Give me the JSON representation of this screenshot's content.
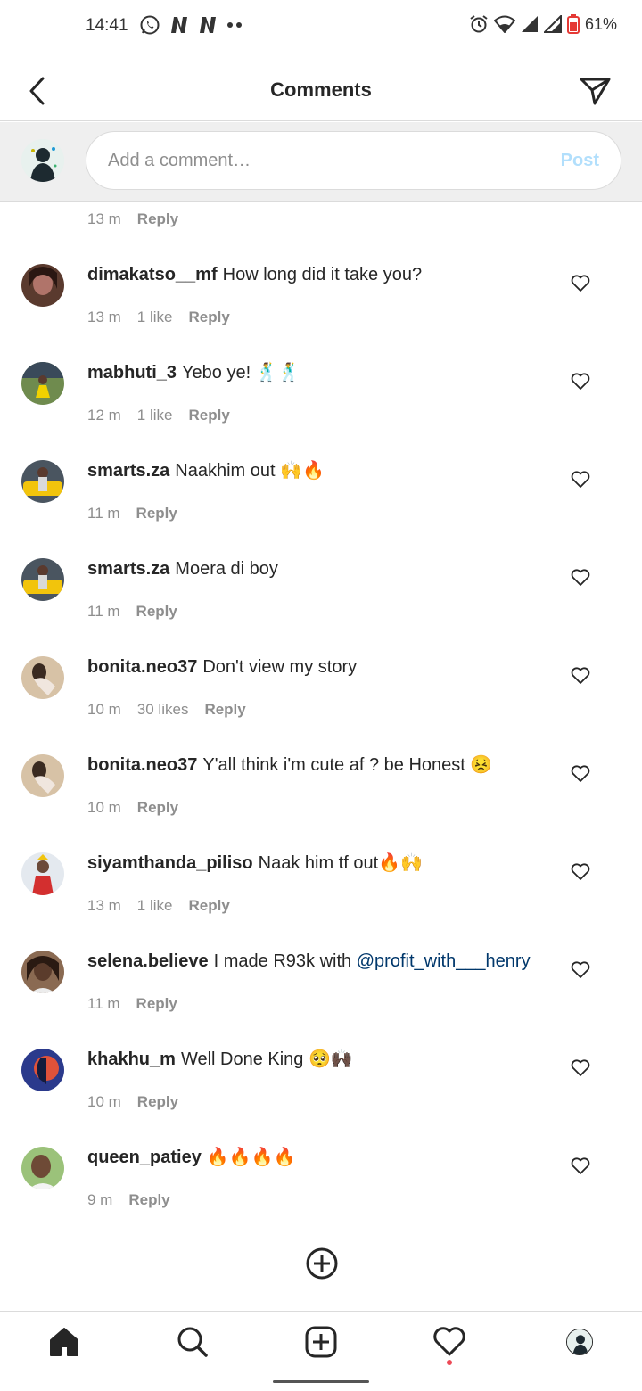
{
  "status_bar": {
    "time": "14:41",
    "battery": "61%",
    "accent_color": "#e53935"
  },
  "header": {
    "title": "Comments",
    "back_icon": "chevron-left-icon",
    "send_icon": "send-icon"
  },
  "composer": {
    "placeholder": "Add a comment…",
    "post_label": "Post"
  },
  "first_meta": {
    "time": "13 m",
    "reply": "Reply"
  },
  "comments": [
    {
      "username": "dimakatso__mf",
      "text": "How long did it take you?",
      "time": "13 m",
      "likes": "1 like",
      "reply": "Reply"
    },
    {
      "username": "mabhuti_3",
      "text": "Yebo ye! 🕺🕺",
      "time": "12 m",
      "likes": "1 like",
      "reply": "Reply"
    },
    {
      "username": "smarts.za",
      "text": "Naakhim out 🙌🔥",
      "time": "11 m",
      "likes": "",
      "reply": "Reply"
    },
    {
      "username": "smarts.za",
      "text": "Moera di boy",
      "time": "11 m",
      "likes": "",
      "reply": "Reply"
    },
    {
      "username": "bonita.neo37",
      "text": "Don't view my story",
      "time": "10 m",
      "likes": "30 likes",
      "reply": "Reply"
    },
    {
      "username": "bonita.neo37",
      "text": "Y'all think i'm cute af ? be Honest 😣",
      "time": "10 m",
      "likes": "",
      "reply": "Reply"
    },
    {
      "username": "siyamthanda_piliso",
      "text": "Naak him tf out🔥🙌",
      "time": "13 m",
      "likes": "1 like",
      "reply": "Reply"
    },
    {
      "username": "selena.believe",
      "text": "I made R93k with",
      "mention": "@profit_with___henry",
      "time": "11 m",
      "likes": "",
      "reply": "Reply"
    },
    {
      "username": "khakhu_m",
      "text": "Well Done King 🥺🙌🏿",
      "time": "10 m",
      "likes": "",
      "reply": "Reply"
    },
    {
      "username": "queen_patiey",
      "text": "🔥🔥🔥🔥",
      "time": "9 m",
      "likes": "",
      "reply": "Reply"
    }
  ],
  "tab_bar": {
    "items": [
      "home-icon",
      "search-icon",
      "create-post-icon",
      "activity-heart-icon",
      "profile-avatar"
    ]
  }
}
